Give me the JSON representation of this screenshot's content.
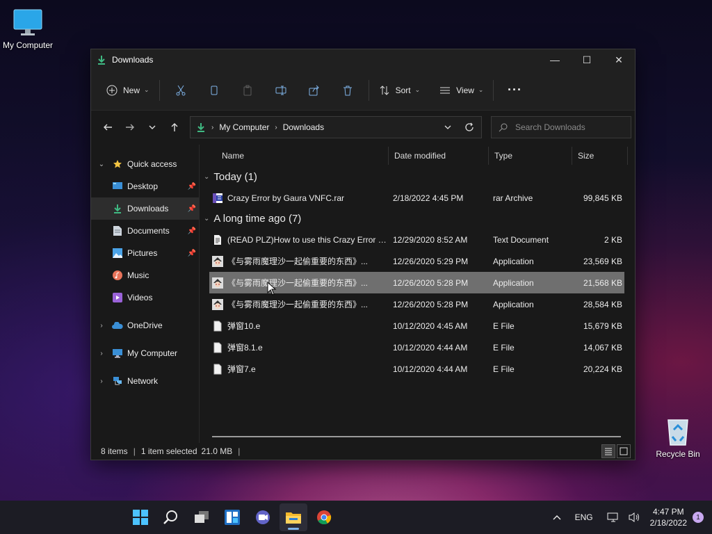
{
  "desktop": {
    "icons": [
      {
        "label": "My Computer",
        "icon": "monitor-icon"
      },
      {
        "label": "Recycle Bin",
        "icon": "recycle-bin-icon"
      }
    ]
  },
  "window": {
    "title": "Downloads",
    "controls": {
      "minimize": "—",
      "maximize": "☐",
      "close": "✕"
    }
  },
  "toolbar": {
    "new_label": "New",
    "sort_label": "Sort",
    "view_label": "View",
    "more_label": "···"
  },
  "address": {
    "crumbs": [
      "My Computer",
      "Downloads"
    ],
    "search_placeholder": "Search Downloads"
  },
  "sidebar": {
    "items": [
      {
        "label": "Quick access",
        "icon": "star-icon",
        "color": "#f4c542"
      },
      {
        "label": "Desktop",
        "icon": "desktop-icon",
        "color": "#3a8fd6"
      },
      {
        "label": "Downloads",
        "icon": "download-icon",
        "color": "#3fb982"
      },
      {
        "label": "Documents",
        "icon": "documents-icon",
        "color": "#cfd6de"
      },
      {
        "label": "Pictures",
        "icon": "pictures-icon",
        "color": "#4aa3e8"
      },
      {
        "label": "Music",
        "icon": "music-icon",
        "color": "#e8735a"
      },
      {
        "label": "Videos",
        "icon": "videos-icon",
        "color": "#9a62d8"
      },
      {
        "label": "OneDrive",
        "icon": "cloud-icon",
        "color": "#3a8fd6"
      },
      {
        "label": "My Computer",
        "icon": "monitor-icon",
        "color": "#3a8fd6"
      },
      {
        "label": "Network",
        "icon": "network-icon",
        "color": "#3a8fd6"
      }
    ]
  },
  "columns": {
    "name": "Name",
    "date": "Date modified",
    "type": "Type",
    "size": "Size"
  },
  "groups": [
    {
      "label": "Today (1)",
      "files": [
        {
          "name": "Crazy Error by Gaura VNFC.rar",
          "date": "2/18/2022 4:45 PM",
          "type": "rar Archive",
          "size": "99,845 KB",
          "icon": "rar-archive-icon"
        }
      ]
    },
    {
      "label": "A long time ago (7)",
      "files": [
        {
          "name": "(READ PLZ)How to use this Crazy Error pr...",
          "date": "12/29/2020 8:52 AM",
          "type": "Text Document",
          "size": "2 KB",
          "icon": "text-file-icon"
        },
        {
          "name": "《与雾雨魔理沙一起偷重要的东西》...",
          "date": "12/26/2020 5:29 PM",
          "type": "Application",
          "size": "23,569 KB",
          "icon": "app-icon"
        },
        {
          "name": "《与雾雨魔理沙一起偷重要的东西》...",
          "date": "12/26/2020 5:28 PM",
          "type": "Application",
          "size": "21,568 KB",
          "icon": "app-icon",
          "selected": true
        },
        {
          "name": "《与雾雨魔理沙一起偷重要的东西》...",
          "date": "12/26/2020 5:28 PM",
          "type": "Application",
          "size": "28,584 KB",
          "icon": "app-icon"
        },
        {
          "name": "弹窗10.e",
          "date": "10/12/2020 4:45 AM",
          "type": "E File",
          "size": "15,679 KB",
          "icon": "blank-file-icon"
        },
        {
          "name": "弹窗8.1.e",
          "date": "10/12/2020 4:44 AM",
          "type": "E File",
          "size": "14,067 KB",
          "icon": "blank-file-icon"
        },
        {
          "name": "弹窗7.e",
          "date": "10/12/2020 4:44 AM",
          "type": "E File",
          "size": "20,224 KB",
          "icon": "blank-file-icon"
        }
      ]
    }
  ],
  "status": {
    "items": "8 items",
    "selected": "1 item selected",
    "size": "21.0 MB"
  },
  "taskbar": {
    "apps": [
      "start-icon",
      "search-icon",
      "task-view-icon",
      "widgets-icon",
      "chat-icon",
      "file-explorer-icon",
      "chrome-icon"
    ],
    "language": "ENG",
    "time": "4:47 PM",
    "date": "2/18/2022",
    "notifications": "1"
  }
}
